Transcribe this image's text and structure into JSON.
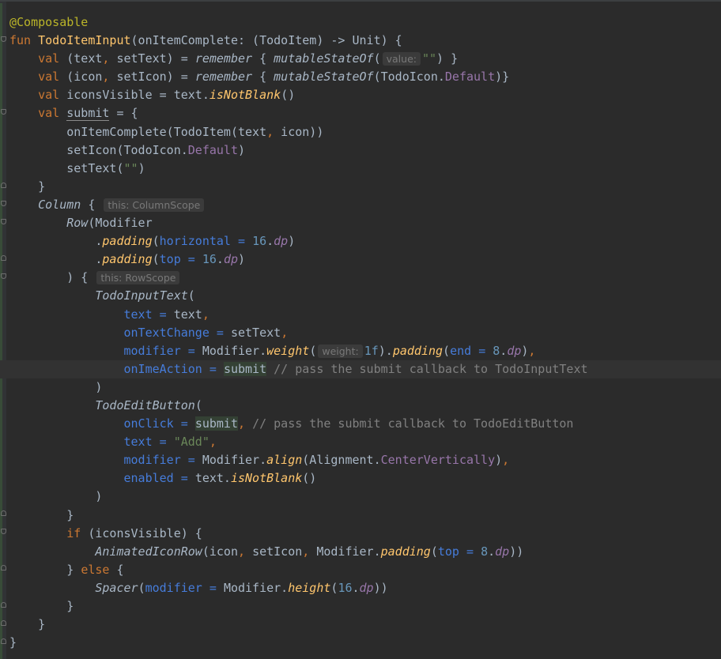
{
  "editor": {
    "language": "Kotlin",
    "theme": "Darcula",
    "colors": {
      "background": "#2b2b2b",
      "keyword": "#cc7832",
      "function": "#ffc66d",
      "annotation": "#bbb529",
      "named_argument": "#467cda",
      "number": "#6897bb",
      "string": "#6a8759",
      "property": "#9876aa",
      "comment": "#808080",
      "text": "#a9b7c6"
    },
    "lines": [
      [
        [
          "annot",
          "@Composable"
        ]
      ],
      [
        [
          "kw",
          "fun "
        ],
        [
          "fn",
          "TodoItemInput"
        ],
        [
          "plain",
          "(onItemComplete: (TodoItem) -> Unit) {"
        ]
      ],
      [
        [
          "plain",
          "    "
        ],
        [
          "kw",
          "val "
        ],
        [
          "plain",
          "(text"
        ],
        [
          "punc",
          ", "
        ],
        [
          "plain",
          "setText) = "
        ],
        [
          "ital",
          "remember"
        ],
        [
          "plain",
          " { "
        ],
        [
          "ital",
          "mutableStateOf"
        ],
        [
          "plain",
          "("
        ],
        [
          "hint",
          "value:"
        ],
        [
          "str",
          "\"\""
        ],
        [
          "plain",
          ") }"
        ]
      ],
      [
        [
          "plain",
          "    "
        ],
        [
          "kw",
          "val "
        ],
        [
          "plain",
          "(icon"
        ],
        [
          "punc",
          ", "
        ],
        [
          "plain",
          "setIcon) = "
        ],
        [
          "ital",
          "remember"
        ],
        [
          "plain",
          " { "
        ],
        [
          "ital",
          "mutableStateOf"
        ],
        [
          "plain",
          "(TodoIcon."
        ],
        [
          "prop",
          "Default"
        ],
        [
          "plain",
          ")}"
        ]
      ],
      [
        [
          "plain",
          "    "
        ],
        [
          "kw",
          "val "
        ],
        [
          "plain",
          "iconsVisible = text."
        ],
        [
          "ext",
          "isNotBlank"
        ],
        [
          "plain",
          "()"
        ]
      ],
      [
        [
          "plain",
          "    "
        ],
        [
          "kw",
          "val "
        ],
        [
          "ul",
          "submit"
        ],
        [
          "plain",
          " = {"
        ]
      ],
      [
        [
          "plain",
          "        onItemComplete(TodoItem(text"
        ],
        [
          "punc",
          ", "
        ],
        [
          "plain",
          "icon))"
        ]
      ],
      [
        [
          "plain",
          "        setIcon(TodoIcon."
        ],
        [
          "prop",
          "Default"
        ],
        [
          "plain",
          ")"
        ]
      ],
      [
        [
          "plain",
          "        setText("
        ],
        [
          "str",
          "\"\""
        ],
        [
          "plain",
          ")"
        ]
      ],
      [
        [
          "plain",
          "    }"
        ]
      ],
      [
        [
          "plain",
          "    "
        ],
        [
          "ital",
          "Column"
        ],
        [
          "plain",
          " { "
        ],
        [
          "hint",
          "this: ColumnScope"
        ]
      ],
      [
        [
          "plain",
          "        "
        ],
        [
          "ital",
          "Row"
        ],
        [
          "plain",
          "(Modifier"
        ]
      ],
      [
        [
          "plain",
          "            ."
        ],
        [
          "ext",
          "padding"
        ],
        [
          "plain",
          "("
        ],
        [
          "named",
          "horizontal = "
        ],
        [
          "num",
          "16"
        ],
        [
          "plain",
          "."
        ],
        [
          "propi",
          "dp"
        ],
        [
          "plain",
          ")"
        ]
      ],
      [
        [
          "plain",
          "            ."
        ],
        [
          "ext",
          "padding"
        ],
        [
          "plain",
          "("
        ],
        [
          "named",
          "top = "
        ],
        [
          "num",
          "16"
        ],
        [
          "plain",
          "."
        ],
        [
          "propi",
          "dp"
        ],
        [
          "plain",
          ")"
        ]
      ],
      [
        [
          "plain",
          "        ) { "
        ],
        [
          "hint",
          "this: RowScope"
        ]
      ],
      [
        [
          "plain",
          "            "
        ],
        [
          "ital",
          "TodoInputText"
        ],
        [
          "plain",
          "("
        ]
      ],
      [
        [
          "plain",
          "                "
        ],
        [
          "named",
          "text = "
        ],
        [
          "plain",
          "text"
        ],
        [
          "punc",
          ","
        ]
      ],
      [
        [
          "plain",
          "                "
        ],
        [
          "named",
          "onTextChange = "
        ],
        [
          "plain",
          "setText"
        ],
        [
          "punc",
          ","
        ]
      ],
      [
        [
          "plain",
          "                "
        ],
        [
          "named",
          "modifier = "
        ],
        [
          "plain",
          "Modifier."
        ],
        [
          "ext",
          "weight"
        ],
        [
          "plain",
          "("
        ],
        [
          "hint",
          "weight:"
        ],
        [
          "num",
          "1f"
        ],
        [
          "plain",
          ")."
        ],
        [
          "ext",
          "padding"
        ],
        [
          "plain",
          "("
        ],
        [
          "named",
          "end = "
        ],
        [
          "num",
          "8"
        ],
        [
          "plain",
          "."
        ],
        [
          "propi",
          "dp"
        ],
        [
          "plain",
          ")"
        ],
        [
          "punc",
          ","
        ]
      ],
      [
        [
          "plain",
          "                "
        ],
        [
          "named",
          "onImeAction = "
        ],
        [
          "hl",
          "submit"
        ],
        [
          "cmt",
          " // pass the submit callback to TodoInputText"
        ]
      ],
      [
        [
          "plain",
          "            )"
        ]
      ],
      [
        [
          "plain",
          "            "
        ],
        [
          "ital",
          "TodoEditButton"
        ],
        [
          "plain",
          "("
        ]
      ],
      [
        [
          "plain",
          "                "
        ],
        [
          "named",
          "onClick = "
        ],
        [
          "hl",
          "submit"
        ],
        [
          "punc",
          ", "
        ],
        [
          "cmt",
          "// pass the submit callback to TodoEditButton"
        ]
      ],
      [
        [
          "plain",
          "                "
        ],
        [
          "named",
          "text = "
        ],
        [
          "str",
          "\"Add\""
        ],
        [
          "punc",
          ","
        ]
      ],
      [
        [
          "plain",
          "                "
        ],
        [
          "named",
          "modifier = "
        ],
        [
          "plain",
          "Modifier."
        ],
        [
          "ext",
          "align"
        ],
        [
          "plain",
          "(Alignment."
        ],
        [
          "prop",
          "CenterVertically"
        ],
        [
          "plain",
          ")"
        ],
        [
          "punc",
          ","
        ]
      ],
      [
        [
          "plain",
          "                "
        ],
        [
          "named",
          "enabled = "
        ],
        [
          "plain",
          "text."
        ],
        [
          "ext",
          "isNotBlank"
        ],
        [
          "plain",
          "()"
        ]
      ],
      [
        [
          "plain",
          "            )"
        ]
      ],
      [
        [
          "plain",
          "        }"
        ]
      ],
      [
        [
          "plain",
          "        "
        ],
        [
          "kw",
          "if "
        ],
        [
          "plain",
          "(iconsVisible) {"
        ]
      ],
      [
        [
          "plain",
          "            "
        ],
        [
          "ital",
          "AnimatedIconRow"
        ],
        [
          "plain",
          "(icon"
        ],
        [
          "punc",
          ", "
        ],
        [
          "plain",
          "setIcon"
        ],
        [
          "punc",
          ", "
        ],
        [
          "plain",
          "Modifier."
        ],
        [
          "ext",
          "padding"
        ],
        [
          "plain",
          "("
        ],
        [
          "named",
          "top = "
        ],
        [
          "num",
          "8"
        ],
        [
          "plain",
          "."
        ],
        [
          "propi",
          "dp"
        ],
        [
          "plain",
          "))"
        ]
      ],
      [
        [
          "plain",
          "        } "
        ],
        [
          "kw",
          "else "
        ],
        [
          "plain",
          "{"
        ]
      ],
      [
        [
          "plain",
          "            "
        ],
        [
          "ital",
          "Spacer"
        ],
        [
          "plain",
          "("
        ],
        [
          "named",
          "modifier = "
        ],
        [
          "plain",
          "Modifier."
        ],
        [
          "ext",
          "height"
        ],
        [
          "plain",
          "("
        ],
        [
          "num",
          "16"
        ],
        [
          "plain",
          "."
        ],
        [
          "propi",
          "dp"
        ],
        [
          "plain",
          "))"
        ]
      ],
      [
        [
          "plain",
          "        }"
        ]
      ],
      [
        [
          "plain",
          "    }"
        ]
      ],
      [
        [
          "plain",
          "}"
        ]
      ]
    ],
    "current_line": 19
  }
}
